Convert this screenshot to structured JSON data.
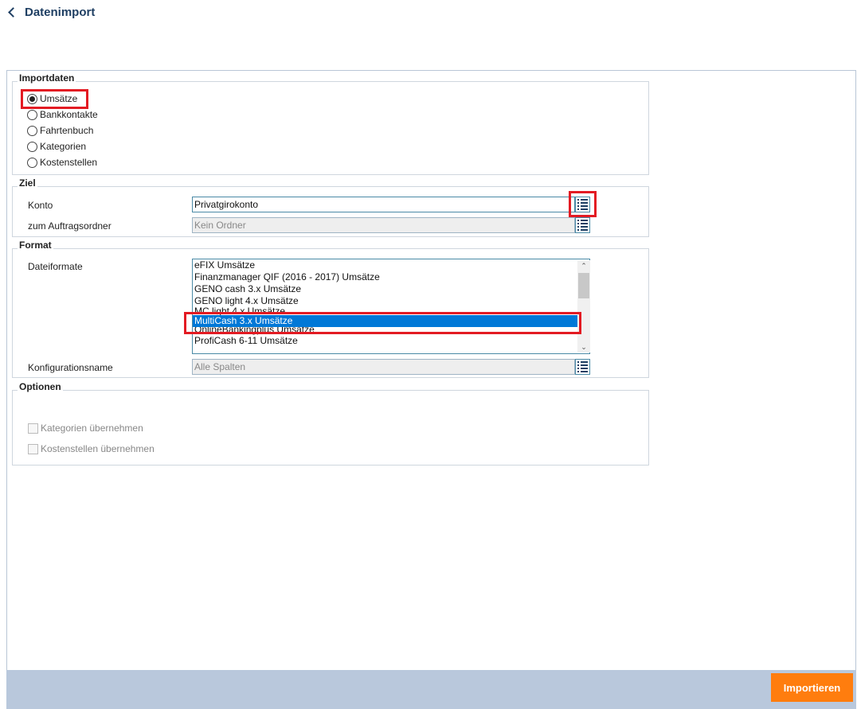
{
  "header": {
    "title": "Datenimport"
  },
  "importdaten": {
    "title": "Importdaten",
    "options": [
      {
        "label": "Umsätze",
        "checked": true
      },
      {
        "label": "Bankkontakte",
        "checked": false
      },
      {
        "label": "Fahrtenbuch",
        "checked": false
      },
      {
        "label": "Kategorien",
        "checked": false
      },
      {
        "label": "Kostenstellen",
        "checked": false
      }
    ]
  },
  "ziel": {
    "title": "Ziel",
    "konto_label": "Konto",
    "konto_value": "Privatgirokonto",
    "ordner_label": "zum Auftragsordner",
    "ordner_value": "Kein Ordner"
  },
  "format": {
    "title": "Format",
    "dateiformate_label": "Dateiformate",
    "items": [
      "eFIX Umsätze",
      "Finanzmanager QIF (2016 - 2017) Umsätze",
      "GENO cash 3.x Umsätze",
      "GENO light 4.x Umsätze",
      "MC light 4.x Umsätze",
      "MultiCash 3.x Umsätze",
      "OnlineBankingplus Umsätze",
      "ProfiCash 6-11 Umsätze"
    ],
    "selected": "MultiCash 3.x Umsätze",
    "konfig_label": "Konfigurationsname",
    "konfig_value": "Alle Spalten"
  },
  "optionen": {
    "title": "Optionen",
    "kategorien_label": "Kategorien übernehmen",
    "kostenstellen_label": "Kostenstellen übernehmen"
  },
  "footer": {
    "import_label": "Importieren"
  },
  "colors": {
    "accent": "#ff7d0e",
    "highlight": "#e31b23",
    "selection": "#0078d7"
  },
  "icons": {
    "back": "chevron-left-icon",
    "list": "list-icon"
  }
}
